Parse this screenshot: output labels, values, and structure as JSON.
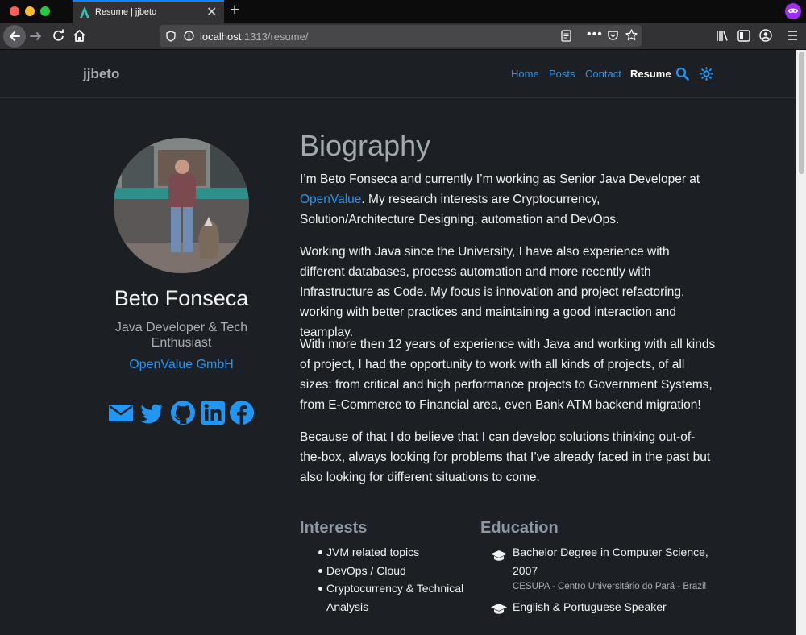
{
  "browser": {
    "tab_title": "Resume | jjbeto",
    "url_host": "localhost",
    "url_path": ":1313/resume/"
  },
  "site": {
    "brand": "jjbeto",
    "menu": [
      "Home",
      "Posts",
      "Contact",
      "Resume"
    ],
    "active_menu": "Resume",
    "accent": "#2196f3"
  },
  "profile": {
    "name": "Beto Fonseca",
    "role": "Java Developer & Tech Enthusiast",
    "organization": "OpenValue GmbH",
    "social": [
      "envelope-icon",
      "twitter-icon",
      "github-icon",
      "linkedin-icon",
      "facebook-icon"
    ]
  },
  "biography": {
    "heading": "Biography",
    "p1_before": "I’m Beto Fonseca and currently I’m working as Senior Java Developer at ",
    "p1_link": "OpenValue",
    "p1_after": ". My research interests are Cryptocurrency, Solution/Architecture Designing, automation and DevOps.",
    "p2": "Working with Java since the University, I have also experience with different databases, process automation and more recently with Infrastructure as Code. My focus is innovation and project refactoring, working with better practices and maintaining a good interaction and teamplay.",
    "p3": "With more then 12 years of experience with Java and working with all kinds of project, I had the opportunity to work with all kinds of projects, of all sizes: from critical and high performance projects to Government Systems, from E-Commerce to Financial area, even Bank ATM backend migration!",
    "p4": "Because of that I do believe that I can develop solutions thinking out-of-the-box, always looking for problems that I’ve already faced in the past but also looking for different situations to come."
  },
  "interests": {
    "heading": "Interests",
    "items": [
      "JVM related topics",
      "DevOps / Cloud",
      "Cryptocurrency & Technical Analysis"
    ]
  },
  "education": {
    "heading": "Education",
    "items": [
      {
        "title": "Bachelor Degree in Computer Science, 2007",
        "institution": "CESUPA - Centro Universitário do Pará - Brazil"
      },
      {
        "title": "English & Portuguese Speaker",
        "institution": ""
      }
    ]
  }
}
